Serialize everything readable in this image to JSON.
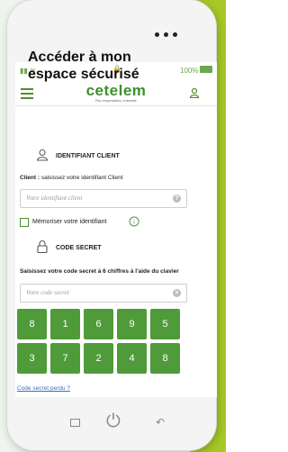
{
  "statusbar": {
    "battery_percent": "100%"
  },
  "header": {
    "logo": "cetelem",
    "logo_tagline": "Plus responsables, ensemble"
  },
  "page_title_line1": "Accéder à mon",
  "page_title_line2": "espace sécurisé",
  "identifiant": {
    "section_label": "IDENTIFIANT CLIENT",
    "field_label_bold": "Client :",
    "field_label_rest": " saisissez votre identifiant Client",
    "placeholder": "Votre identifiant client",
    "help": "?"
  },
  "remember": {
    "label": "Mémoriser votre identifiant",
    "info": "i"
  },
  "secret": {
    "section_label": "CODE SECRET",
    "instruction": "Saisissez votre code secret à 6 chiffres à l'aide du clavier",
    "placeholder": "Votre code secret",
    "clear": "×"
  },
  "keypad": {
    "keys": [
      "8",
      "1",
      "6",
      "9",
      "5",
      "3",
      "7",
      "2",
      "4",
      "8"
    ]
  },
  "forgot_link": "Code secret perdu ?",
  "colors": {
    "brand_green": "#4f9b3a",
    "accent_lime": "#a6c927"
  }
}
